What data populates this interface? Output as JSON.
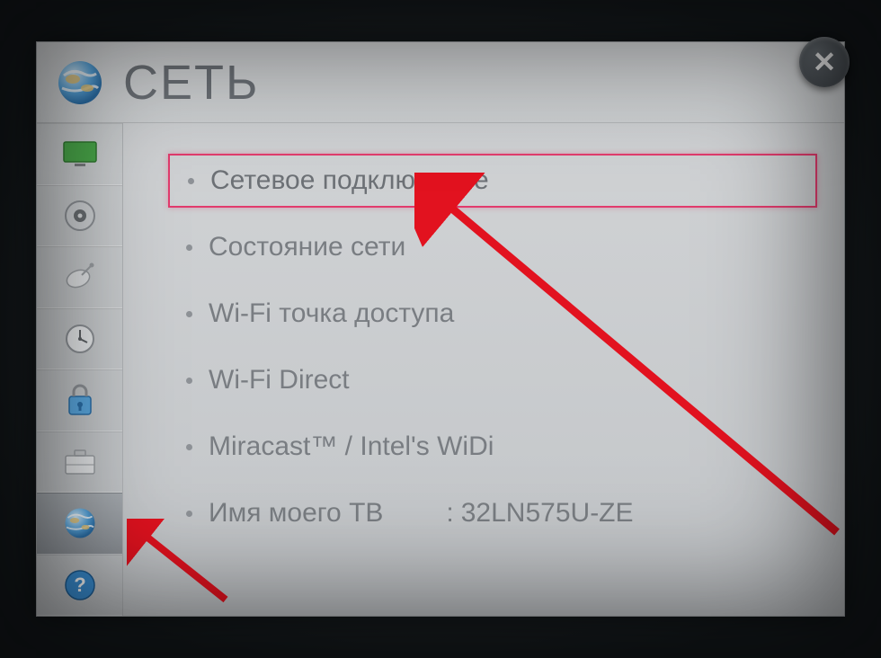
{
  "header": {
    "title": "СЕТЬ"
  },
  "closeLabel": "✕",
  "sidebar": {
    "items": [
      {
        "name": "picture",
        "active": false
      },
      {
        "name": "sound",
        "active": false
      },
      {
        "name": "channel",
        "active": false
      },
      {
        "name": "time",
        "active": false
      },
      {
        "name": "lock",
        "active": false
      },
      {
        "name": "option",
        "active": false
      },
      {
        "name": "network",
        "active": true
      },
      {
        "name": "support",
        "active": false
      }
    ]
  },
  "menu": {
    "items": [
      {
        "label": "Сетевое подключение",
        "highlight": true
      },
      {
        "label": "Состояние сети",
        "highlight": false
      },
      {
        "label": "Wi-Fi точка доступа",
        "highlight": false
      },
      {
        "label": "Wi-Fi Direct",
        "highlight": false
      },
      {
        "label": "Miracast™ / Intel's WiDi",
        "highlight": false
      },
      {
        "label": "Имя моего ТВ",
        "value": "32LN575U-ZE",
        "highlight": false
      }
    ]
  }
}
